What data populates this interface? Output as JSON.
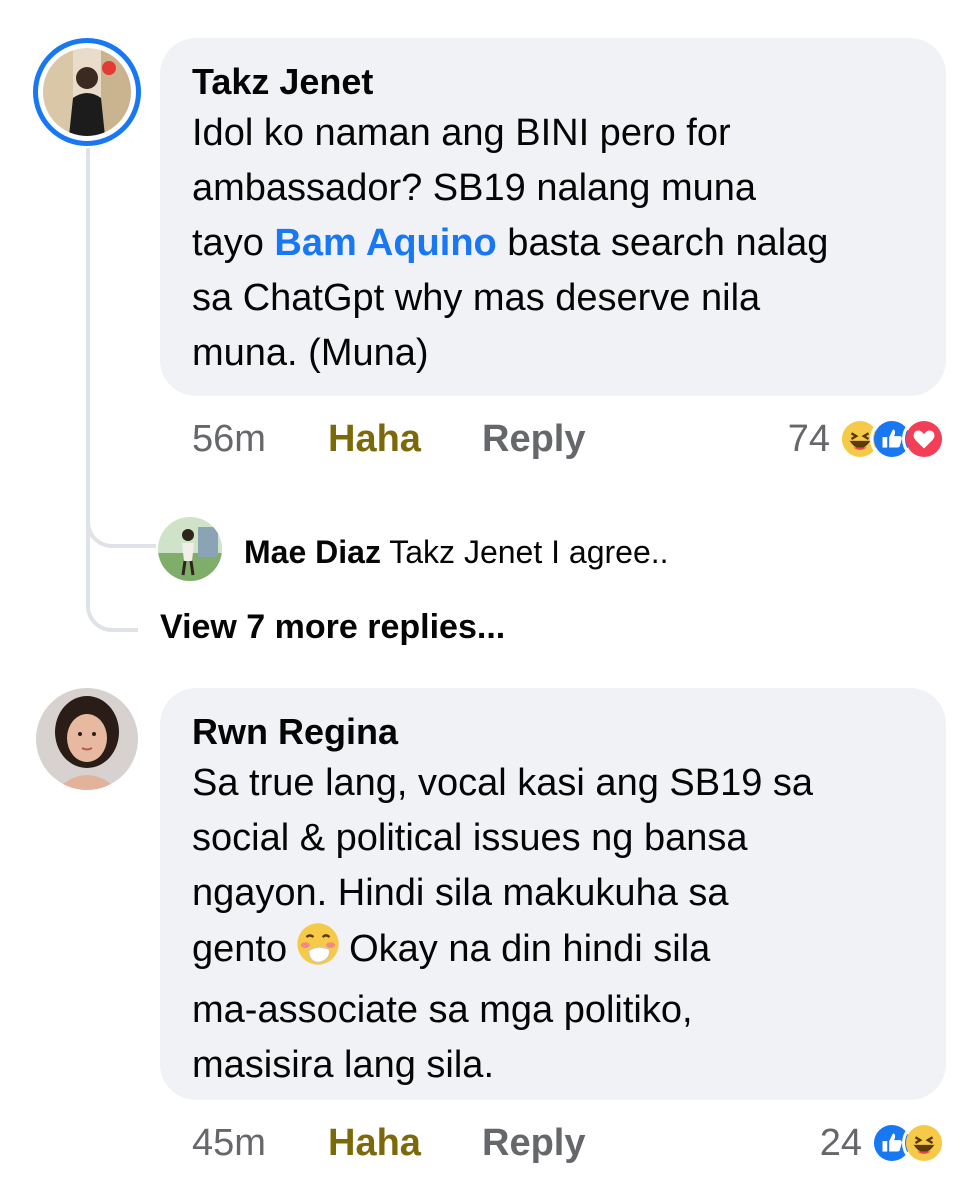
{
  "comments": [
    {
      "author": "Takz Jenet",
      "text_before_mention": "Idol ko naman ang BINI pero for\nambassador? SB19 nalang muna\ntayo ",
      "mention": "Bam Aquino",
      "text_after_mention": " basta search nalag\nsa ChatGpt why mas deserve nila\nmuna. (Muna)",
      "time": "56m",
      "reaction_label": "Haha",
      "reply_label": "Reply",
      "reaction_count": "74",
      "reaction_icons": [
        "haha-icon",
        "like-icon",
        "love-icon"
      ],
      "reply": {
        "author": "Mae Diaz",
        "text": "Takz Jenet I agree.."
      },
      "view_more": "View 7 more replies..."
    },
    {
      "author": "Rwn Regina",
      "text_part1": "Sa true lang, vocal kasi ang SB19 sa\nsocial & political issues ng bansa\nngayon. Hindi sila makukuha sa\ngento",
      "inline_emoji": "face-with-hand-over-mouth-icon",
      "text_part2": "Okay na din hindi sila\nma-associate sa mga politiko,\nmasisira lang sila.",
      "time": "45m",
      "reaction_label": "Haha",
      "reply_label": "Reply",
      "reaction_count": "24",
      "reaction_icons": [
        "like-icon",
        "haha-icon"
      ]
    }
  ],
  "colors": {
    "accent": "#1877f2",
    "bubble": "#f0f2f5",
    "haha_text": "#7c6a0a",
    "meta_text": "#65676b"
  }
}
